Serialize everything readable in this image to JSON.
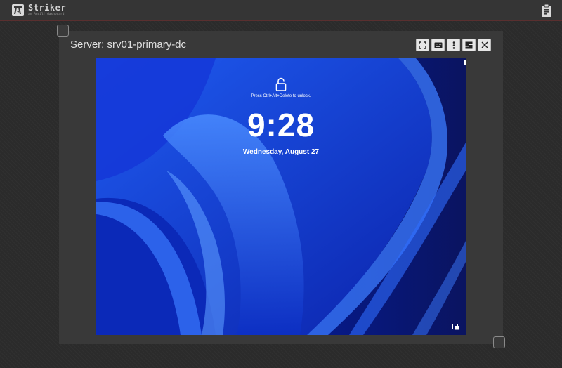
{
  "app": {
    "name": "Striker",
    "subtitle": "an Anvil! dashboard",
    "header_icon": "clipboard-icon"
  },
  "panel": {
    "title": "Server: srv01-primary-dc",
    "toolbar": [
      {
        "name": "fullscreen-button",
        "icon": "fullscreen-icon"
      },
      {
        "name": "keyboard-button",
        "icon": "keyboard-icon"
      },
      {
        "name": "more-options-button",
        "icon": "more-vert-icon"
      },
      {
        "name": "dashboard-view-button",
        "icon": "dashboard-icon"
      },
      {
        "name": "close-button",
        "icon": "close-icon"
      }
    ]
  },
  "lockscreen": {
    "hint": "Press Ctrl+Alt+Delete to unlock.",
    "time": "9:28",
    "date": "Wednesday, August 27",
    "lock_icon": "unlock-icon",
    "corner_icon": "accessibility-icon"
  },
  "colors": {
    "page_bg": "#2b2b2b",
    "header_bg": "#353535",
    "header_border": "#5a2f2f",
    "panel_bg": "#393939",
    "wallpaper_blue": "#0d2cc6",
    "button_bg": "#e6e6e6"
  }
}
